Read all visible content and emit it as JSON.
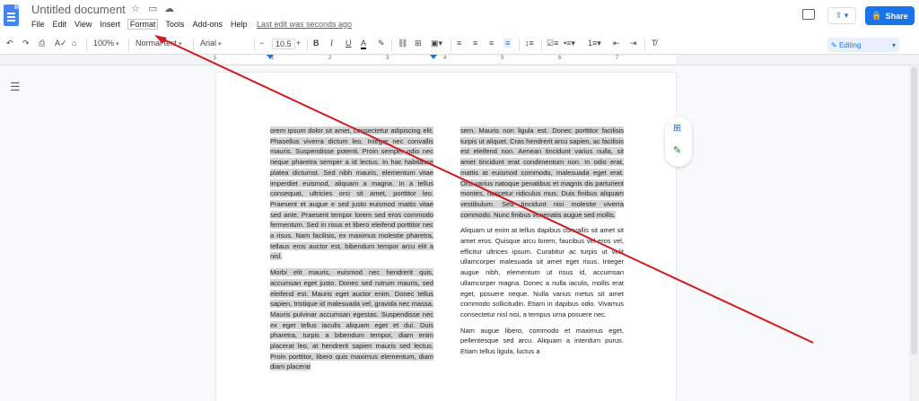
{
  "header": {
    "doc_title": "Untitled document",
    "menu": [
      "File",
      "Edit",
      "View",
      "Insert",
      "Format",
      "Tools",
      "Add-ons",
      "Help"
    ],
    "last_edit": "Last edit was seconds ago",
    "share_label": "Share",
    "star_icon": "star-icon",
    "folder_icon": "folder-icon",
    "cloud_icon": "cloud-icon"
  },
  "toolbar": {
    "zoom": "100%",
    "style": "Normal text",
    "font": "Arial",
    "size": "10.5",
    "mode": "Editing"
  },
  "ruler": {
    "numbers": [
      "1",
      "1",
      "2",
      "3",
      "4",
      "5",
      "6",
      "7"
    ]
  },
  "document": {
    "left_column": [
      "orem ipsum dolor sit amet, consectetur adipiscing elit. Phasellus viverra dictum leo. Integer nec convallis mauris. Suspendisse potenti. Proin semper odio nec neque pharetra semper a id lectus. In hac habitasse platea dictumst. Sed nibh mauris, elementum vitae imperdiet euismod, aliquam a magna. In a tellus consequat, ultricies orci sit amet, porttitor leo. Praesent et augue e sed justo euismod mattis vitae sed ante. Praesent tempor lorem sed eros commodo fermentum. Sed in risus et libero eleifend porttitor nec a risus. Nam facilisis, ex maximus molestie pharetra, tellaus eros auctor est, bibendum tempor arcu elit a nisl.",
      "Morbi elit mauris, euismod nec hendrerit quis, accumsan eget justo. Donec sed rutrum mauris, sed eleifend est. Mauris eget auctor enim. Donec tellus sapien, tristique id malesuada vel, gravida nec massa. Mauris pulvinar accumsan egestas. Suspendisse nec ex eget tellus iaculis aliquam eget et dui. Duis pharetra, turpis a bibendum tempor, diam enim placerat leo, at hendrerit sapien mauris sed lectus. Proin porttitor, libero quis maximus elementum, diam diam placerat"
    ],
    "right_column": [
      "sem. Mauris non ligula est. Donec porttitor facilisis turpis ut aliquet. Cras hendrerit arcu sapien, ac facilisis est eleifend non. Aenean tincidunt varius nulla, sit amet tincidunt erat condimentum non. In odio erat, mattis at euismod commodo, malesuada eget erat. Orci varius natoque penatibus et magnis dis parturient montes, nascetur ridiculus mus. Duis finibus aliquam vestibulum. Sed tincidunt nisi molestie viverra commodo. Nunc finibus venenatis augue sed mollis.",
      "Aliquam ut enim at tellus dapibus convallis sit amet sit amet eros. Quisque arcu lorem, faucibus vel eros vel, efficitur ultrices ipsum. Curabitur ac turpis ut velit ullamcorper malesuada sit amet eget risus. Integer augue nibh, elementum ut risus id, accumsan ullamcorper magna. Donec a nulla iaculis, mollis erat eget, posuere neque. Nulla varius metus sit amet commodo sollicitudin. Etiam in dapibus odio. Vivamus consectetur nisl nisi, a tempus urna posuere nec.",
      "Nam augue libero, commodo et maximus eget, pellentesque sed arcu. Aliquam a interdum purus. Etiam tellus ligula, luctus a"
    ]
  },
  "colors": {
    "accent": "#1a73e8",
    "arrow": "#cc1e24",
    "highlight": "#d6d6d6"
  }
}
